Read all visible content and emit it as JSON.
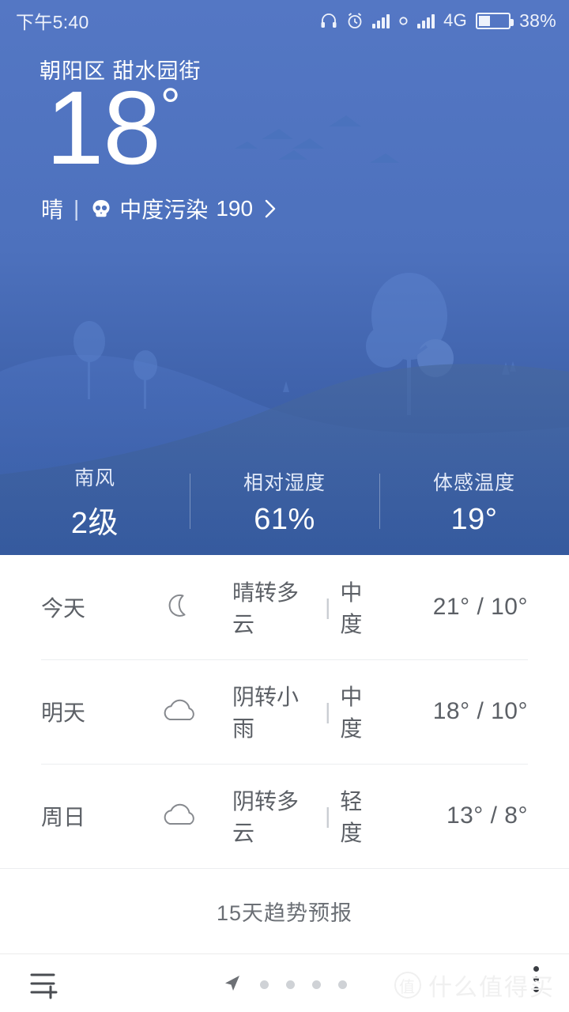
{
  "status_bar": {
    "time": "下午5:40",
    "network_label": "4G",
    "battery_percent": "38%",
    "icons": [
      "headphone-icon",
      "alarm-clock-icon",
      "signal-bars-icon",
      "small-circle-icon",
      "signal-bars-icon"
    ]
  },
  "hero": {
    "location": "朝阳区  甜水园街",
    "temperature": "18",
    "degree_symbol": "°",
    "condition": "晴",
    "separator": "|",
    "air_quality_icon": "skull-icon",
    "air_quality_text": "中度污染",
    "air_quality_index": "190",
    "chevron": "chevron-right-icon",
    "sky_color": "#4f73be",
    "ground_color": "#2b5298",
    "text_color": "#ffffff"
  },
  "stats": [
    {
      "label": "南风",
      "value": "2级"
    },
    {
      "label": "相对湿度",
      "value": "61%"
    },
    {
      "label": "体感温度",
      "value": "19°"
    }
  ],
  "forecast": {
    "rows": [
      {
        "day": "今天",
        "icon": "moon-icon",
        "desc": "晴转多云",
        "sep": "|",
        "aqi_level": "中度",
        "temps": "21° / 10°"
      },
      {
        "day": "明天",
        "icon": "cloud-icon",
        "desc": "阴转小雨",
        "sep": "|",
        "aqi_level": "中度",
        "temps": "18° / 10°"
      },
      {
        "day": "周日",
        "icon": "cloud-icon",
        "desc": "阴转多云",
        "sep": "|",
        "aqi_level": "轻度",
        "temps": "13° / 8°"
      }
    ]
  },
  "trend_button": {
    "label": "15天趋势预报"
  },
  "bottom_bar": {
    "add_city_icon": "list-add-icon",
    "location_icon": "location-arrow-icon",
    "page_dots": 4,
    "menu_icon": "overflow-menu-icon"
  },
  "watermark": {
    "badge": "值",
    "text": "什么值得买"
  }
}
